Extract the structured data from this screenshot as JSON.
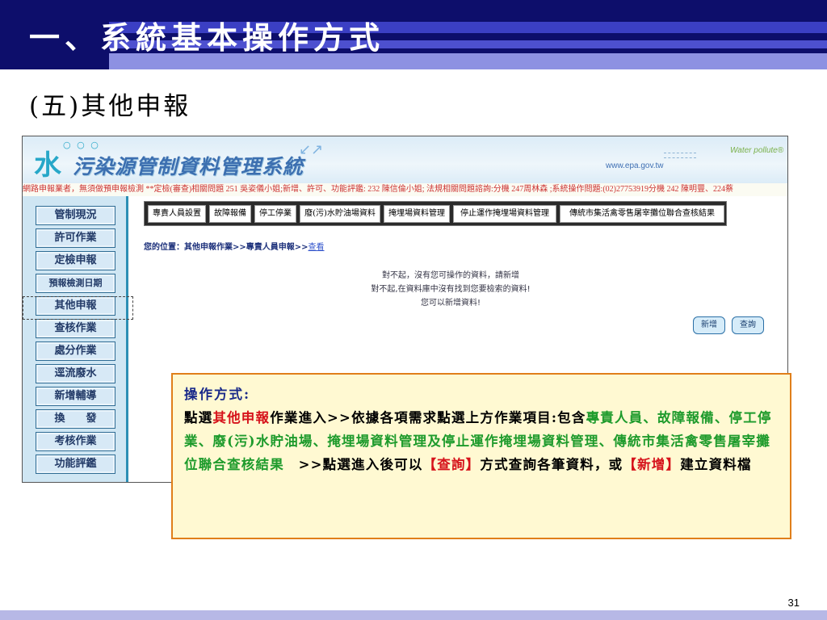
{
  "slide": {
    "title": "一、系統基本操作方式",
    "subtitle": "(五)其他申報",
    "page_number": "31"
  },
  "app": {
    "logo_mark": "水",
    "logo_text": "污染源管制資料管理系統",
    "site_url": "www.epa.gov.tw",
    "brand": "Water pollute®",
    "marquee": "網路申報業者，無須做預申報檢測 **定檢(審查)相關問題 251 吳姿儀小姐;新增、許可、功能評鑑: 232 陳信倫小姐; 法規相關問題諮詢:分機 247周林森 ;系統操作問題:(02)27753919分機 242 陳明豐、224蔡",
    "nav_items": [
      "管制現況",
      "許可作業",
      "定檢申報",
      "預報檢測日期",
      "其他申報",
      "查核作業",
      "處分作業",
      "逕流廢水",
      "新增輔導",
      "換　　發",
      "考核作業",
      "功能評鑑"
    ],
    "tabs": [
      "專責人員設置",
      "故障報備",
      "停工停業",
      "廢(污)水貯油場資料",
      "掩埋場資料管理",
      "停止運作掩埋場資料管理",
      "傳統市集活禽零售屠宰攤位聯合查核結果"
    ],
    "breadcrumb": {
      "prefix": "您的位置：",
      "path": "其他申報作業>>專責人員申報>>",
      "link": "查看"
    },
    "messages": [
      "對不起，沒有您可操作的資料，請新增",
      "對不起,在資料庫中沒有找到您要檢索的資料!",
      "您可以新增資料!"
    ],
    "buttons": {
      "add": "新增",
      "query": "查詢"
    }
  },
  "callout": {
    "label": "操作方式:",
    "t1": "點選",
    "t2": "其他申報",
    "t3": "作業進入>>依據各項需求點選上方作業項目:包含",
    "t4": "專責人員、故障報備、停工停業、廢(污)水貯油場、掩埋場資料管理及停止運作掩埋場資料管理、傳統市集活禽零售屠宰攤位聯合查核結果",
    "t5": "　>>點選進入後可以",
    "t6": "【查詢】",
    "t7": "方式查詢各筆資料，或",
    "t8": "【新增】",
    "t9": "建立資料檔"
  },
  "colors": {
    "header_navy": "#0d0e6b",
    "callout_border": "#e07f1a",
    "highlight_red": "#d6131b",
    "highlight_green": "#1e9b2c"
  }
}
